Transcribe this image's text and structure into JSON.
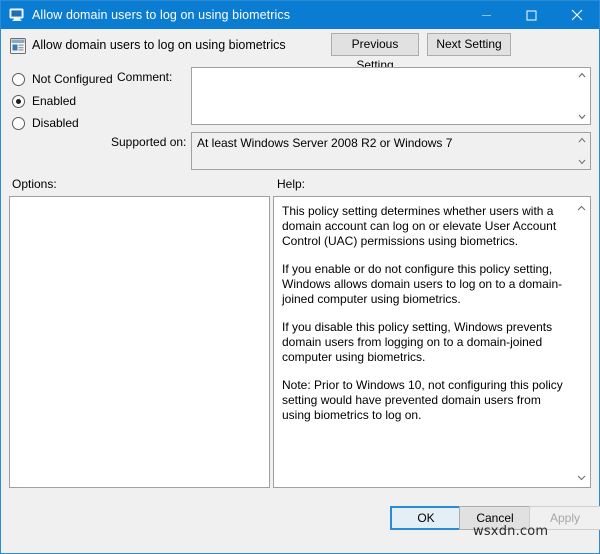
{
  "window": {
    "title": "Allow domain users to log on using biometrics",
    "title_icon": "policy-monitor-icon",
    "controls": {
      "minimize_icon": "minimize-icon",
      "maximize_icon": "maximize-icon",
      "close_icon": "close-icon"
    },
    "accent_color": "#0a7cd1",
    "body_color": "#f0f0f0"
  },
  "header": {
    "icon": "policy-setting-icon",
    "title": "Allow domain users to log on using biometrics",
    "previous_setting_label": "Previous Setting",
    "next_setting_label": "Next Setting"
  },
  "config": {
    "options": [
      {
        "label": "Not Configured",
        "selected": false
      },
      {
        "label": "Enabled",
        "selected": true
      },
      {
        "label": "Disabled",
        "selected": false
      }
    ],
    "comment_label": "Comment:",
    "comment_value": "",
    "supported_label": "Supported on:",
    "supported_value": "At least Windows Server 2008 R2 or Windows 7"
  },
  "panels": {
    "options_label": "Options:",
    "help_label": "Help:",
    "options_content": "",
    "help_paragraphs": [
      "This policy setting determines whether users with a domain account can log on or elevate User Account Control (UAC) permissions using biometrics.",
      "If you enable or do not configure this policy setting, Windows allows domain users to log on to a domain-joined computer using biometrics.",
      "If you disable this policy setting, Windows prevents domain users from logging on to a domain-joined computer using biometrics.",
      "Note: Prior to Windows 10, not configuring this policy setting would have prevented domain users from using biometrics to log on."
    ]
  },
  "footer": {
    "ok_label": "OK",
    "cancel_label": "Cancel",
    "apply_label": "Apply",
    "apply_disabled": true,
    "watermark": "wsxdn.com"
  }
}
